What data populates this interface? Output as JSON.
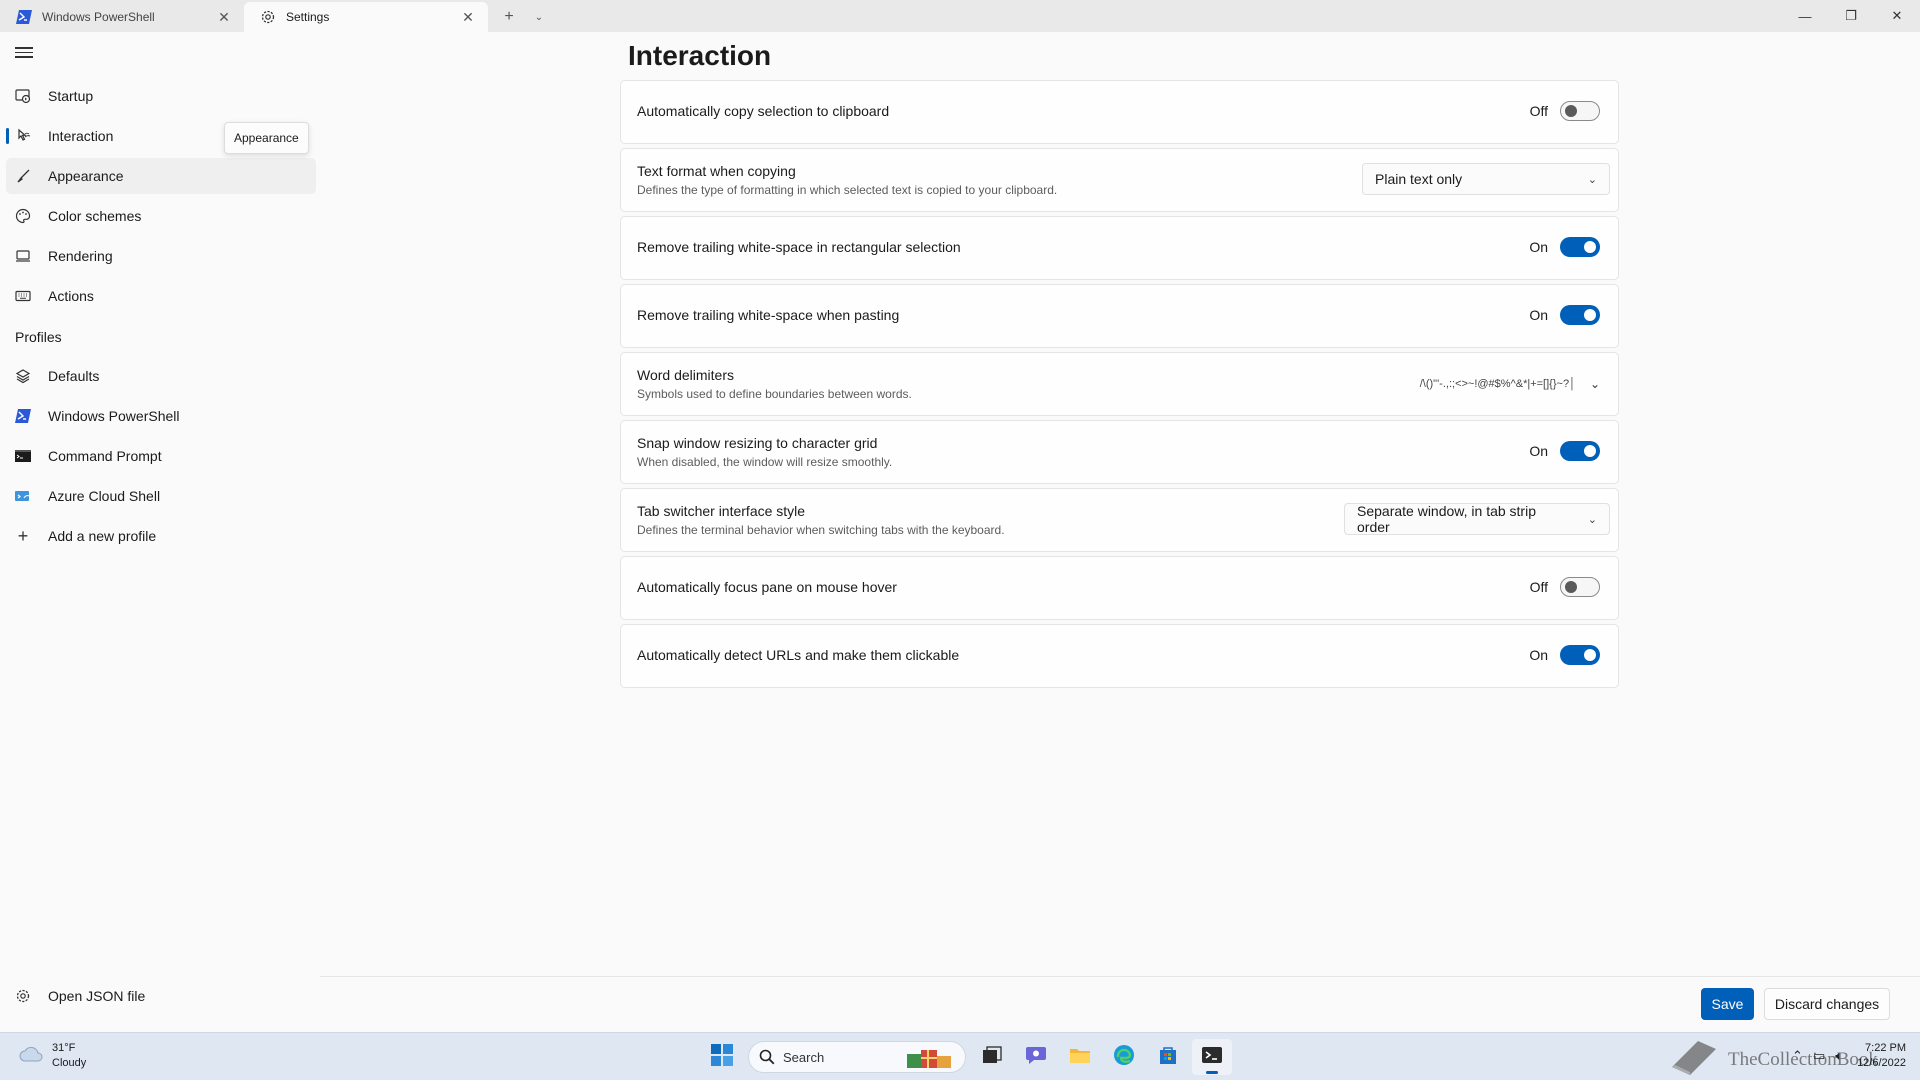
{
  "tabs": [
    {
      "label": "Windows PowerShell",
      "icon": "powershell-icon",
      "active": false
    },
    {
      "label": "Settings",
      "icon": "gear-icon",
      "active": true
    }
  ],
  "sidebar": {
    "items": [
      {
        "label": "Startup",
        "icon": "startup-icon"
      },
      {
        "label": "Interaction",
        "icon": "interaction-icon",
        "selected": true
      },
      {
        "label": "Appearance",
        "icon": "brush-icon",
        "hover": true
      },
      {
        "label": "Color schemes",
        "icon": "palette-icon"
      },
      {
        "label": "Rendering",
        "icon": "monitor-icon"
      },
      {
        "label": "Actions",
        "icon": "keyboard-icon"
      }
    ],
    "profiles_header": "Profiles",
    "profiles": [
      {
        "label": "Defaults",
        "icon": "layers-icon"
      },
      {
        "label": "Windows PowerShell",
        "icon": "powershell-icon"
      },
      {
        "label": "Command Prompt",
        "icon": "cmd-icon"
      },
      {
        "label": "Azure Cloud Shell",
        "icon": "azure-icon"
      },
      {
        "label": "Add a new profile",
        "icon": "plus-icon"
      }
    ],
    "tooltip": "Appearance",
    "open_json": "Open JSON file"
  },
  "page": {
    "title": "Interaction",
    "settings": [
      {
        "title": "Automatically copy selection to clipboard",
        "desc": "",
        "control": "toggle",
        "state": "Off"
      },
      {
        "title": "Text format when copying",
        "desc": "Defines the type of formatting in which selected text is copied to your clipboard.",
        "control": "dropdown",
        "value": "Plain text only"
      },
      {
        "title": "Remove trailing white-space in rectangular selection",
        "desc": "",
        "control": "toggle",
        "state": "On"
      },
      {
        "title": "Remove trailing white-space when pasting",
        "desc": "",
        "control": "toggle",
        "state": "On"
      },
      {
        "title": "Word delimiters",
        "desc": "Symbols used to define boundaries between words.",
        "control": "expander",
        "value": "/\\()\"'-.,:;<>~!@#$%^&*|+=[]{}~?│"
      },
      {
        "title": "Snap window resizing to character grid",
        "desc": "When disabled, the window will resize smoothly.",
        "control": "toggle",
        "state": "On"
      },
      {
        "title": "Tab switcher interface style",
        "desc": "Defines the terminal behavior when switching tabs with the keyboard.",
        "control": "dropdown",
        "value": "Separate window, in tab strip order"
      },
      {
        "title": "Automatically focus pane on mouse hover",
        "desc": "",
        "control": "toggle",
        "state": "Off"
      },
      {
        "title": "Automatically detect URLs and make them clickable",
        "desc": "",
        "control": "toggle",
        "state": "On"
      }
    ]
  },
  "footer": {
    "save": "Save",
    "discard": "Discard changes"
  },
  "taskbar": {
    "weather_temp": "31°F",
    "weather_desc": "Cloudy",
    "search_placeholder": "Search",
    "time": "7:22 PM",
    "date": "12/6/2022",
    "watermark": "TheCollectionBook"
  },
  "colors": {
    "accent": "#005fb8",
    "taskbar": "#dfe7f2"
  }
}
